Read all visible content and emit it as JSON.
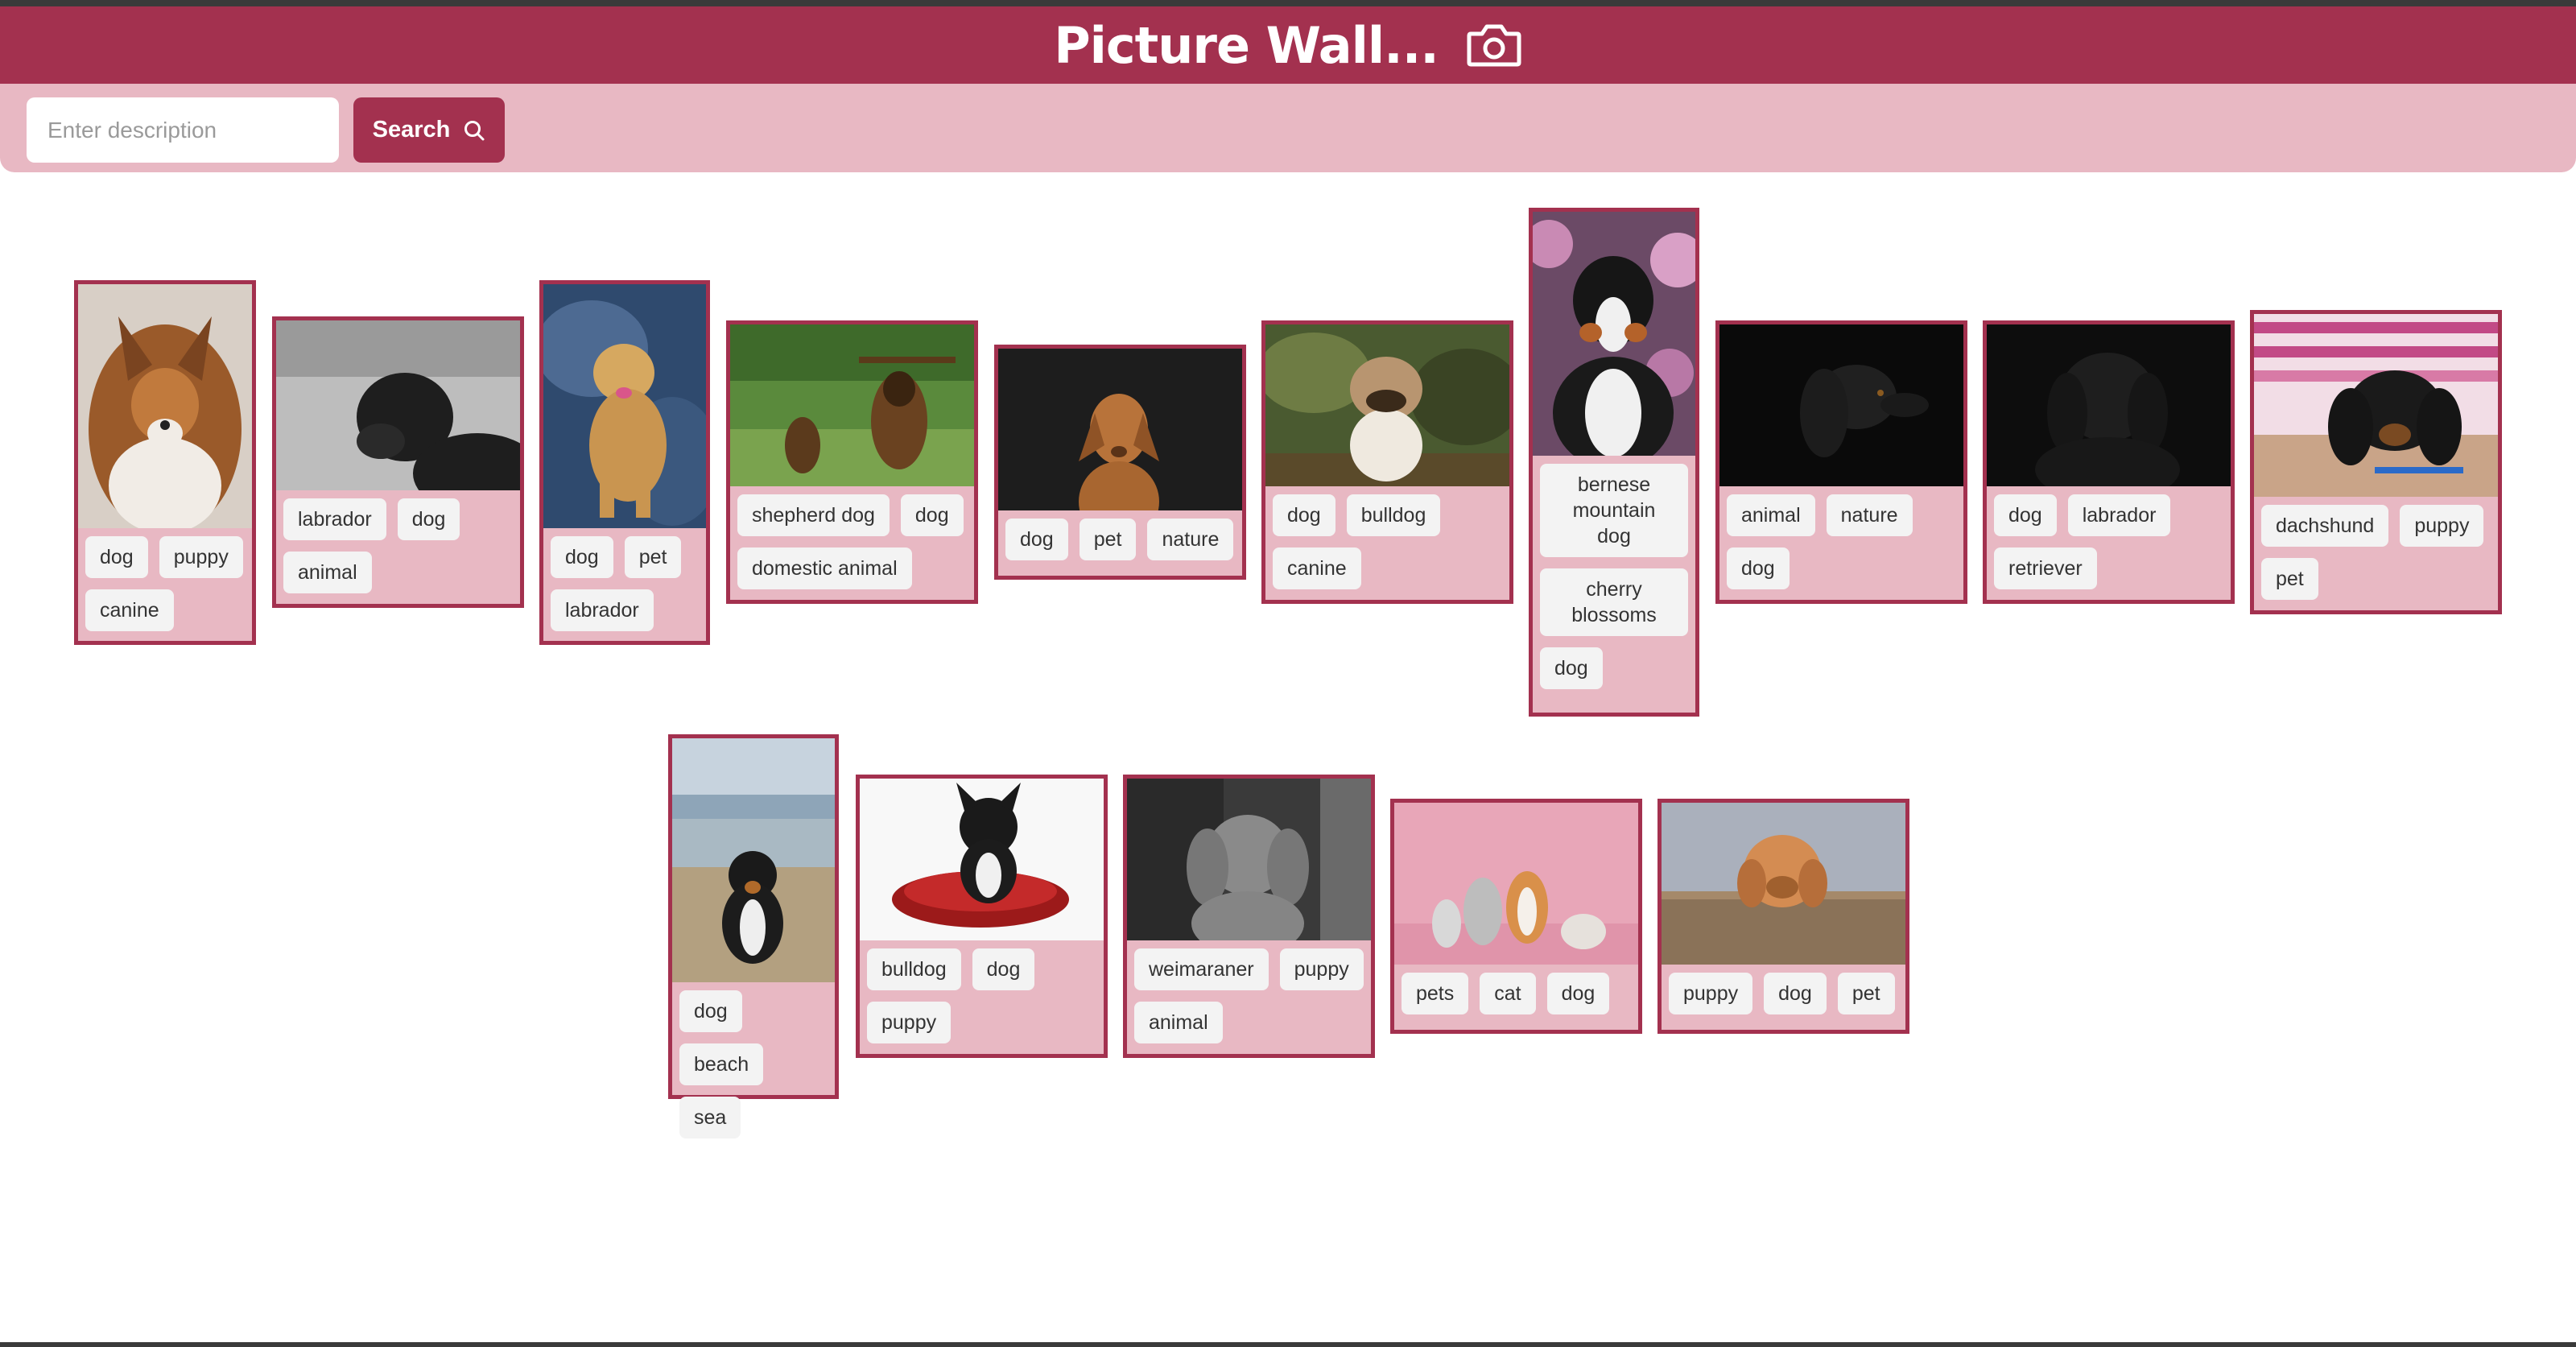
{
  "header": {
    "title": "Picture Wall...",
    "icon": "camera-icon"
  },
  "search": {
    "placeholder": "Enter description",
    "value": "",
    "button_label": "Search",
    "button_icon": "search-icon"
  },
  "colors": {
    "accent": "#a3314f",
    "panel": "#e8b8c3",
    "tag_bg": "#f3f3f3"
  },
  "cards": [
    {
      "tags": [
        "dog",
        "puppy",
        "canine"
      ]
    },
    {
      "tags": [
        "labrador",
        "dog",
        "animal"
      ]
    },
    {
      "tags": [
        "dog",
        "pet",
        "labrador"
      ]
    },
    {
      "tags": [
        "shepherd dog",
        "dog",
        "domestic animal"
      ]
    },
    {
      "tags": [
        "dog",
        "pet",
        "nature"
      ]
    },
    {
      "tags": [
        "dog",
        "bulldog",
        "canine"
      ]
    },
    {
      "tags": [
        "bernese mountain dog",
        "cherry blossoms",
        "dog"
      ]
    },
    {
      "tags": [
        "animal",
        "nature",
        "dog"
      ]
    },
    {
      "tags": [
        "dog",
        "labrador",
        "retriever"
      ]
    },
    {
      "tags": [
        "dachshund",
        "puppy",
        "pet"
      ]
    },
    {
      "tags": [
        "dog",
        "beach",
        "sea"
      ]
    },
    {
      "tags": [
        "bulldog",
        "dog",
        "puppy"
      ]
    },
    {
      "tags": [
        "weimaraner",
        "puppy",
        "animal"
      ]
    },
    {
      "tags": [
        "pets",
        "cat",
        "dog"
      ]
    },
    {
      "tags": [
        "puppy",
        "dog",
        "pet"
      ]
    }
  ]
}
